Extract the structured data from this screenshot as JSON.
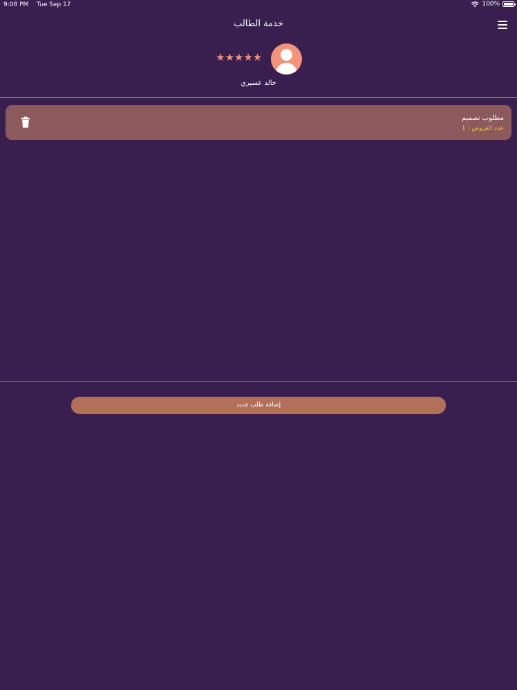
{
  "status_bar": {
    "time": "9:08 PM",
    "date": "Tue Sep 17",
    "battery_percent": "100%",
    "battery_level": 1.0,
    "wifi_icon": "wifi-icon",
    "battery_icon": "battery-icon"
  },
  "nav": {
    "title": "خدمة الطالب",
    "menu_icon": "hamburger-menu-icon"
  },
  "profile": {
    "name": "خالد عسيري",
    "rating": 5,
    "stars": "★★★★★",
    "avatar_icon": "user-avatar-icon"
  },
  "requests": [
    {
      "title": "مطلوب تصميم",
      "offers": "عدد العروض : 1",
      "delete_icon": "trash-icon"
    }
  ],
  "actions": {
    "add_request_label": "إضافة طلب جديد"
  },
  "colors": {
    "background": "#381f50",
    "accent": "#f2937a",
    "card": "#8c5a5d",
    "button": "#b2705c",
    "offers_text": "#f0c23a"
  }
}
